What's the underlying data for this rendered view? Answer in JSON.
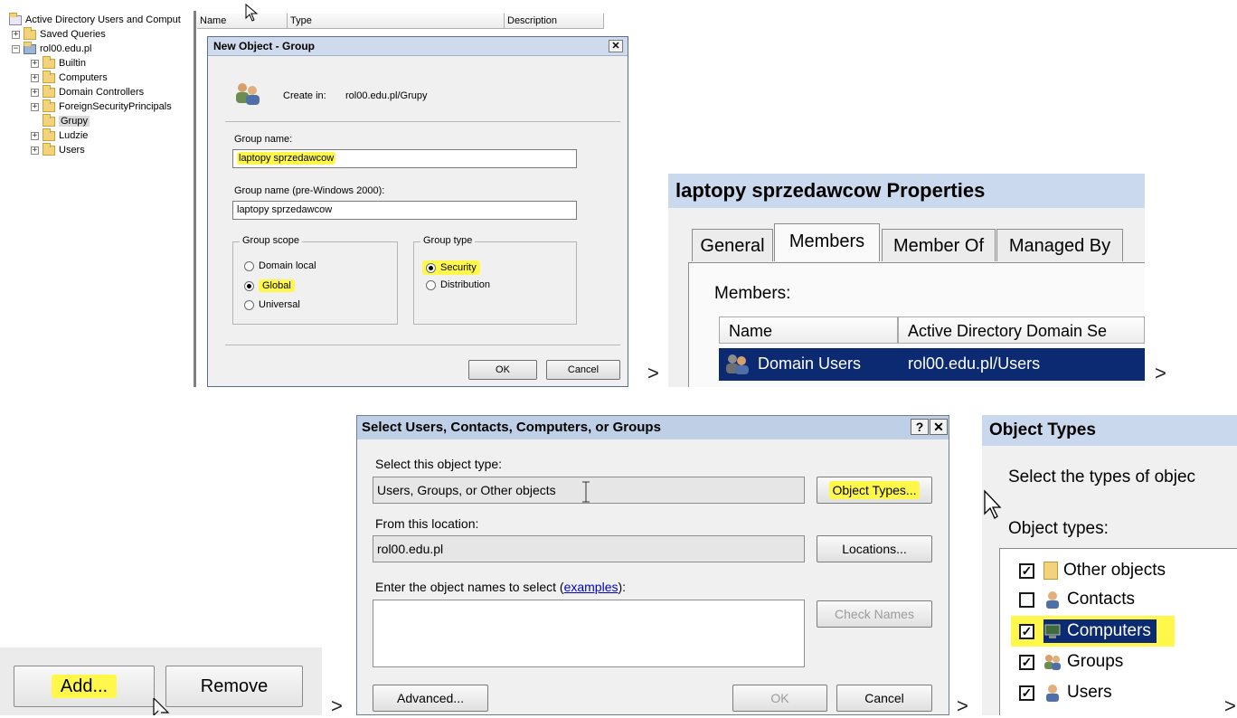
{
  "tree": {
    "root": "Active Directory Users and Comput",
    "items": [
      {
        "label": "Saved Queries",
        "exp": "+"
      },
      {
        "label": "rol00.edu.pl",
        "exp": "−"
      },
      {
        "label": "Builtin",
        "exp": "+"
      },
      {
        "label": "Computers",
        "exp": "+"
      },
      {
        "label": "Domain Controllers",
        "exp": "+"
      },
      {
        "label": "ForeignSecurityPrincipals",
        "exp": "+"
      },
      {
        "label": "Grupy",
        "exp": ""
      },
      {
        "label": "Ludzie",
        "exp": "+"
      },
      {
        "label": "Users",
        "exp": "+"
      }
    ]
  },
  "list_headers": {
    "name": "Name",
    "type": "Type",
    "description": "Description"
  },
  "new_group": {
    "title": "New Object - Group",
    "close": "✕",
    "create_in_label": "Create in:",
    "create_in_value": "rol00.edu.pl/Grupy",
    "group_name_label": "Group name:",
    "group_name_value": "laptopy sprzedawcow",
    "pre2000_label": "Group name (pre-Windows 2000):",
    "pre2000_value": "laptopy sprzedawcow",
    "scope_legend": "Group scope",
    "scope_options": [
      "Domain local",
      "Global",
      "Universal"
    ],
    "type_legend": "Group type",
    "type_options": [
      "Security",
      "Distribution"
    ],
    "ok": "OK",
    "cancel": "Cancel"
  },
  "arrows": {
    "a1": ">",
    "a2": ">",
    "a3": ">",
    "a4": ">",
    "a5": ">"
  },
  "props": {
    "title": "laptopy sprzedawcow Properties",
    "tabs": [
      "General",
      "Members",
      "Member Of",
      "Managed By"
    ],
    "members_label": "Members:",
    "col_name": "Name",
    "col_folder": "Active Directory Domain Se",
    "row_name": "Domain Users",
    "row_folder": "rol00.edu.pl/Users"
  },
  "member_buttons": {
    "add": "Add...",
    "remove": "Remove"
  },
  "select_dialog": {
    "title": "Select Users, Contacts, Computers, or Groups",
    "help": "?",
    "close": "✕",
    "object_type_label": "Select this object type:",
    "object_type_value": "Users, Groups, or Other objects",
    "object_types_btn": "Object Types...",
    "location_label": "From this location:",
    "location_value": "rol00.edu.pl",
    "locations_btn": "Locations...",
    "enter_label": "Enter the object names to select (",
    "examples": "examples",
    "enter_label_end": "):",
    "check_names": "Check Names",
    "advanced": "Advanced...",
    "ok": "OK",
    "cancel": "Cancel"
  },
  "object_types": {
    "title": "Object Types",
    "prompt": "Select the types of objec",
    "list_label": "Object types:",
    "items": [
      {
        "label": "Other objects",
        "checked": true
      },
      {
        "label": "Contacts",
        "checked": false
      },
      {
        "label": "Computers",
        "checked": true
      },
      {
        "label": "Groups",
        "checked": true
      },
      {
        "label": "Users",
        "checked": true
      }
    ]
  },
  "colors": {
    "highlight": "#fff84a",
    "selection": "#0b2a72"
  }
}
